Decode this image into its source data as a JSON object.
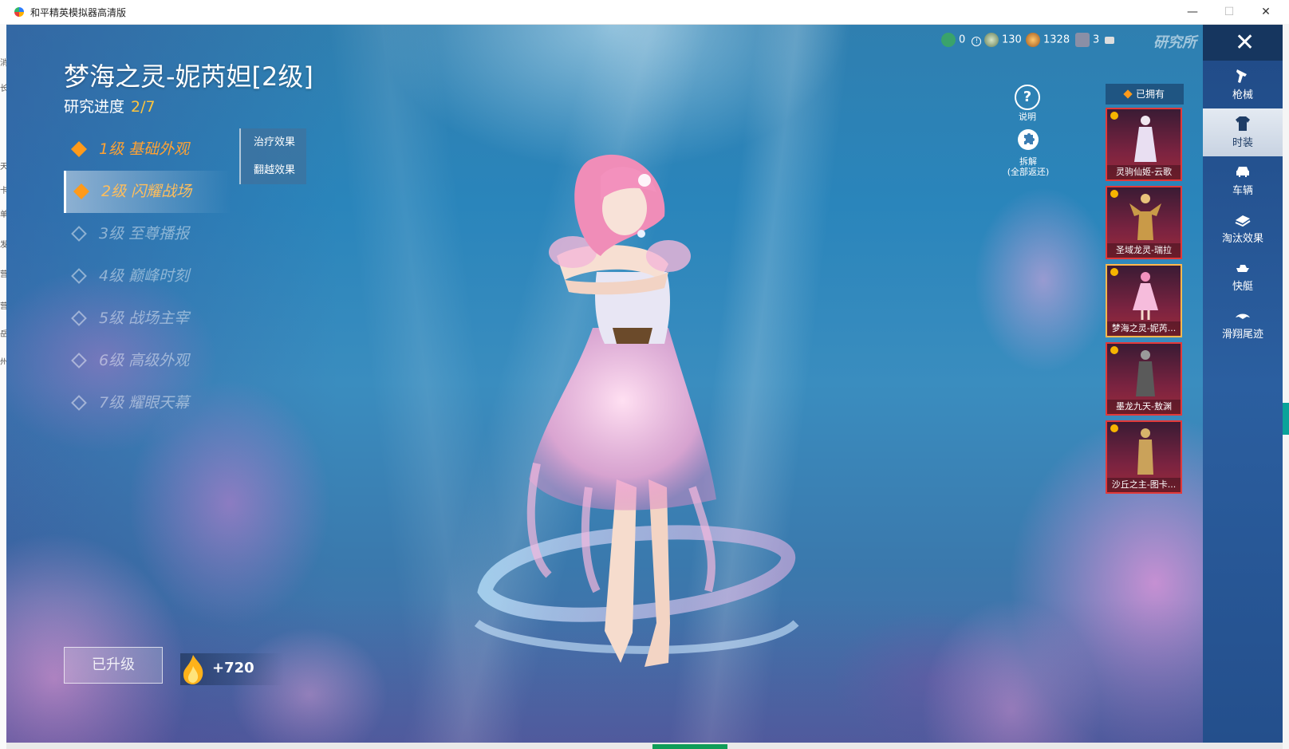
{
  "window": {
    "title": "和平精英模拟器高清版",
    "minimize": "—",
    "maximize": "☐",
    "close": "✕"
  },
  "left_strip_chars": [
    "消",
    "长",
    "天",
    "卡",
    "单",
    "发",
    "营",
    "营",
    "岳",
    "州"
  ],
  "currency": {
    "c1_value": "0",
    "c2_value": "130",
    "c3_value": "1328",
    "c4_value": "3"
  },
  "lab_title": "研究所",
  "skin": {
    "title": "梦海之灵-妮芮妲[2级]",
    "progress_label": "研究进度",
    "progress_value": "2/7"
  },
  "levels": [
    {
      "label": "1级 基础外观",
      "state": "unlocked"
    },
    {
      "label": "2级 闪耀战场",
      "state": "active"
    },
    {
      "label": "3级 至尊播报",
      "state": "locked"
    },
    {
      "label": "4级 巅峰时刻",
      "state": "locked"
    },
    {
      "label": "5级 战场主宰",
      "state": "locked"
    },
    {
      "label": "6级 高级外观",
      "state": "locked"
    },
    {
      "label": "7级 耀眼天幕",
      "state": "locked"
    }
  ],
  "effects": [
    "治疗效果",
    "翻越效果"
  ],
  "upgrade_button": "已升级",
  "reward_value": "+720",
  "help_label": "说明",
  "disassemble_label": "拆解",
  "disassemble_sub": "(全部返还)",
  "owned": {
    "header": "已拥有",
    "items": [
      {
        "name": "灵驹仙姬-云歌"
      },
      {
        "name": "圣域龙灵-瑞拉"
      },
      {
        "name": "梦海之灵-妮芮..."
      },
      {
        "name": "墨龙九天-敖渊"
      },
      {
        "name": "沙丘之主-图卡..."
      }
    ]
  },
  "nav": {
    "items": [
      {
        "label": "枪械"
      },
      {
        "label": "时装"
      },
      {
        "label": "车辆"
      },
      {
        "label": "淘汰效果"
      },
      {
        "label": "快艇"
      },
      {
        "label": "滑翔尾迹"
      }
    ]
  },
  "colors": {
    "accent_orange": "#ffa233",
    "progress_yellow": "#ffc53d",
    "card_border_red": "#e23a3a",
    "nav_blue": "#2b5fa0"
  }
}
